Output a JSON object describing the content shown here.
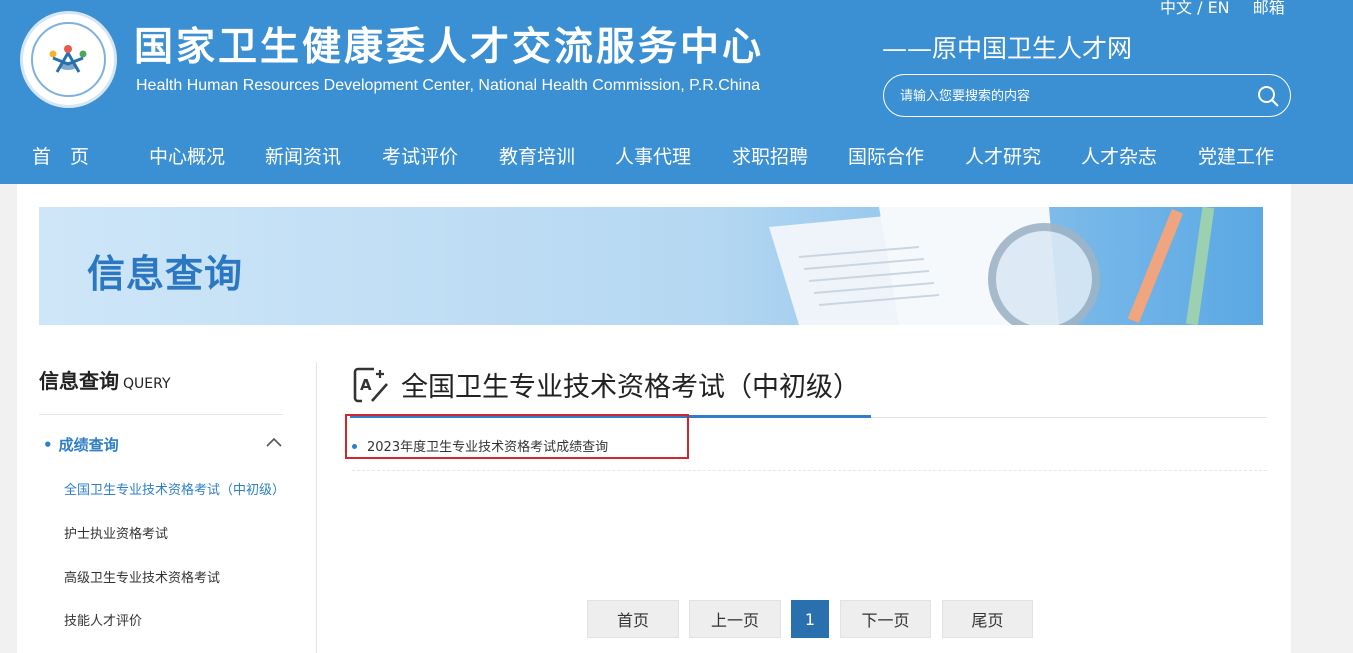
{
  "header": {
    "title_cn": "国家卫生健康委人才交流服务中心",
    "title_en": "Health Human Resources Development Center, National Health Commission, P.R.China",
    "subtitle": "——原中国卫生人才网",
    "lang_switch": "中文 / EN",
    "mail": "邮箱",
    "search_placeholder": "请输入您要搜索的内容",
    "logo_icon": "emblem-logo",
    "search_icon": "magnifier-icon"
  },
  "nav": [
    "首　页",
    "中心概况",
    "新闻资讯",
    "考试评价",
    "教育培训",
    "人事代理",
    "求职招聘",
    "国际合作",
    "人才研究",
    "人才杂志",
    "党建工作"
  ],
  "banner": {
    "title": "信息查询"
  },
  "sidebar": {
    "title": "信息查询",
    "title_en": "QUERY",
    "category": "成绩查询",
    "category_dot": "•",
    "items": [
      "全国卫生专业技术资格考试（中初级）",
      "护士执业资格考试",
      "高级卫生专业技术资格考试",
      "技能人才评价"
    ],
    "active_index": 0
  },
  "main": {
    "title": "全国卫生专业技术资格考试（中初级）",
    "list": [
      "2023年度卫生专业技术资格考试成绩查询"
    ]
  },
  "pager": {
    "first": "首页",
    "prev": "上一页",
    "current": "1",
    "next": "下一页",
    "last": "尾页"
  },
  "colors": {
    "header_bg": "#3b8fd3",
    "accent": "#2f7fc8",
    "pager_active": "#2a6fae",
    "highlight": "#d0282e"
  }
}
